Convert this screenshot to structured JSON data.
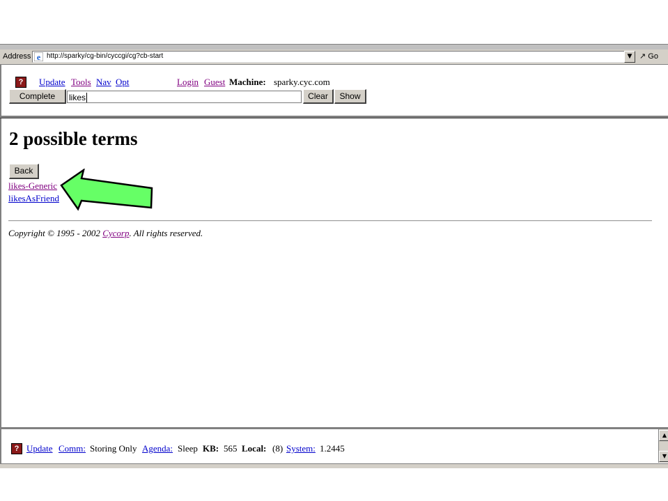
{
  "address_bar": {
    "label": "Address",
    "url": "http://sparky/cg-bin/cyccgi/cg?cb-start",
    "go_label": "Go"
  },
  "toolbar": {
    "help_glyph": "?",
    "links": {
      "update": "Update",
      "tools": "Tools",
      "nav": "Nav",
      "opt": "Opt",
      "login": "Login",
      "guest": "Guest"
    },
    "machine_label": "Machine:",
    "machine_value": "sparky.cyc.com",
    "complete_label": "Complete",
    "input_value": "likes",
    "clear_label": "Clear",
    "show_label": "Show"
  },
  "main": {
    "heading": "2 possible terms",
    "back_label": "Back",
    "terms": [
      "likes-Generic",
      "likesAsFriend"
    ],
    "copyright_prefix": "Copyright © 1995 - 2002 ",
    "copyright_link": "Cycorp",
    "copyright_suffix": ". All rights reserved."
  },
  "annotation": {
    "arrow_color": "#66ff66",
    "arrow_points_to": "likes-Generic"
  },
  "status_bar": {
    "help_glyph": "?",
    "update": "Update",
    "comm": "Comm:",
    "comm_value": "Storing Only",
    "agenda": "Agenda:",
    "agenda_value": "Sleep",
    "kb_label": "KB:",
    "kb_value": "565",
    "local_label": "Local:",
    "local_value": "(8)",
    "system": "System:",
    "system_value": "1.2445"
  }
}
